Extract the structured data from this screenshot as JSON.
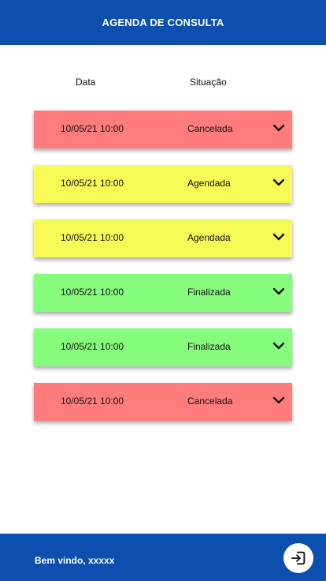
{
  "header": {
    "title": "AGENDA DE CONSULTA"
  },
  "columns": {
    "date": "Data",
    "status": "Situação"
  },
  "colors": {
    "primary": "#0d4faf",
    "Cancelada": "#ff7c7c",
    "Agendada": "#f7fa55",
    "Finalizada": "#86fc7c"
  },
  "appointments": [
    {
      "date": "10/05/21 10:00",
      "status": "Cancelada"
    },
    {
      "date": "10/05/21 10:00",
      "status": "Agendada"
    },
    {
      "date": "10/05/21 10:00",
      "status": "Agendada"
    },
    {
      "date": "10/05/21 10:00",
      "status": "Finalizada"
    },
    {
      "date": "10/05/21 10:00",
      "status": "Finalizada"
    },
    {
      "date": "10/05/21 10:00",
      "status": "Cancelada"
    }
  ],
  "footer": {
    "welcome": "Bem vindo, xxxxx",
    "logout_icon": "logout-icon"
  }
}
